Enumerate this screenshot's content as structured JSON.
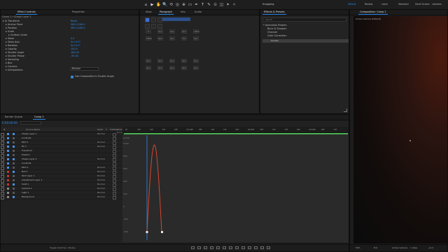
{
  "colors": {
    "accent": "#2d8ceb",
    "curve": "#d7452f",
    "work_area": "#4caf50",
    "playhead": "#2d8ceb"
  },
  "toolbar": {
    "icons": [
      "home-icon",
      "selection-arrow-icon",
      "hand-icon",
      "zoom-icon",
      "rotate-icon",
      "camera-orbit-icon",
      "pan-behind-icon",
      "rectangle-icon",
      "pen-icon",
      "type-icon",
      "brush-icon",
      "clone-stamp-icon",
      "eraser-icon",
      "roto-brush-icon",
      "puppet-pin-icon"
    ],
    "glyphs": [
      "⌂",
      "▶",
      "✋",
      "🔍",
      "⟲",
      "◎",
      "⊕",
      "▭",
      "✒",
      "T",
      "✎",
      "⊙",
      "◫",
      "✦",
      "✧"
    ],
    "snapping_label": "Snapping",
    "workspaces": [
      "Default",
      "Review",
      "Learn",
      "Standard",
      "Small Screen",
      "Libraries"
    ]
  },
  "effect_controls": {
    "tabs": [
      "Effect Controls",
      "Properties"
    ],
    "layer_line": "Comp 1 • Shape Layer 1",
    "rows": [
      {
        "label": "fx  Transform",
        "value": "Reset",
        "indent": 0
      },
      {
        "label": "Anchor Point",
        "value": "960.0,540.0",
        "indent": 1
      },
      {
        "label": "Position",
        "value": "960.0,540.0",
        "indent": 1
      },
      {
        "label": "Scale",
        "value": "",
        "indent": 1
      },
      {
        "label": "Uniform Scale",
        "value": "",
        "indent": 2
      },
      {
        "label": "Skew",
        "value": "0.0",
        "indent": 1
      },
      {
        "label": "Skew Axis",
        "value": "0x+0.0°",
        "indent": 1
      },
      {
        "label": "Rotation",
        "value": "0x+0.0°",
        "indent": 1
      },
      {
        "label": "Opacity",
        "value": "100.0",
        "indent": 1
      },
      {
        "label": "Shutter Angle",
        "value": "180.00",
        "indent": 1
      },
      {
        "label": "Shutter Phase",
        "value": "-90.00",
        "indent": 1
      },
      {
        "label": "Sampling",
        "value": "",
        "indent": 1
      },
      {
        "label": "Blur",
        "value": "",
        "indent": 1
      },
      {
        "label": "Camera",
        "value": "",
        "indent": 1
      },
      {
        "label": "Interpolation",
        "value": "",
        "indent": 1
      }
    ],
    "dropdown_value": "Bilinear",
    "checkbox_label": "Use Composition's Shutter Angle"
  },
  "middle": {
    "tabs": [
      "Align",
      "Paragraph",
      "Info",
      "Audio"
    ],
    "grid_labels": [
      "0",
      "0px",
      "0px",
      "0px",
      "100%",
      "100%",
      "0px",
      "0px",
      "0%",
      "0px",
      "0px",
      "0px",
      "0px",
      "0px",
      "0px",
      "0px",
      "0px",
      "0px",
      "0px",
      "0px"
    ],
    "swatches": [
      "#3a6fd8",
      "#2a2a2a",
      "#2a2a2a",
      "#2a2a2a",
      "#2a2a2a",
      "#2a2a2a"
    ]
  },
  "libraries": {
    "tab": "Effects & Presets",
    "search_placeholder": "Search",
    "items": [
      "* Animation Presets",
      "Blurs & Sharpen",
      "Channel",
      "Color Correction"
    ],
    "selected": "Curves"
  },
  "composition": {
    "tab": "Composition: Comp 1",
    "label": "Active Camera (Default)",
    "footer": [
      "50%",
      "Full",
      "Active Camera",
      "1 View",
      "+0.0"
    ]
  },
  "timeline": {
    "tabs": [
      "Render Queue",
      "Comp 1"
    ],
    "timecode": "0:00:00:00",
    "columns": [
      "#",
      "Source Name",
      "Mode",
      "T",
      "TrkMat",
      "Parent & Link"
    ],
    "layers": [
      {
        "name": "Shape Layer 1",
        "color": "#4a90e2",
        "mode": "Normal"
      },
      {
        "name": "Contents",
        "color": "#4a90e2",
        "mode": ""
      },
      {
        "name": "Path 1",
        "color": "#4a90e2",
        "mode": "Normal"
      },
      {
        "name": "Fill 1",
        "color": "#4a90e2",
        "mode": "Normal"
      },
      {
        "name": "Transform",
        "color": "#4a90e2",
        "mode": ""
      },
      {
        "name": "Position",
        "color": "#4a90e2",
        "mode": ""
      },
      {
        "name": "Shape Layer 2",
        "color": "#4a90e2",
        "mode": "Normal"
      },
      {
        "name": "Contents",
        "color": "#4a90e2",
        "mode": ""
      },
      {
        "name": "Path 1",
        "color": "#4a90e2",
        "mode": "Normal"
      },
      {
        "name": "Null 1",
        "color": "#c0392b",
        "mode": "Normal"
      },
      {
        "name": "Text Layer 1",
        "color": "#c0392b",
        "mode": "Normal"
      },
      {
        "name": "Adjustment Layer 1",
        "color": "#c0392b",
        "mode": "Normal"
      },
      {
        "name": "Solid 1",
        "color": "#c0392b",
        "mode": "Normal"
      },
      {
        "name": "Camera 1",
        "color": "#888888",
        "mode": "Normal"
      },
      {
        "name": "Light 1",
        "color": "#888888",
        "mode": "Normal"
      },
      {
        "name": "Background",
        "color": "#888888",
        "mode": "Normal"
      }
    ],
    "ruler_ticks": [
      "0f",
      "05f",
      "10f",
      "15f",
      "20f",
      "01:00f",
      "05f",
      "10f",
      "15f",
      "20f",
      "02:00f",
      "05f",
      "10f",
      "15f",
      "20f",
      "03:00f",
      "05f",
      "10f"
    ],
    "graph_y_labels": [
      "1000",
      "800",
      "600",
      "400",
      "200",
      "0",
      "-200",
      "-400"
    ],
    "graph_ylabel": "px/sec",
    "footer_toggle": "Toggle Switches / Modes"
  }
}
